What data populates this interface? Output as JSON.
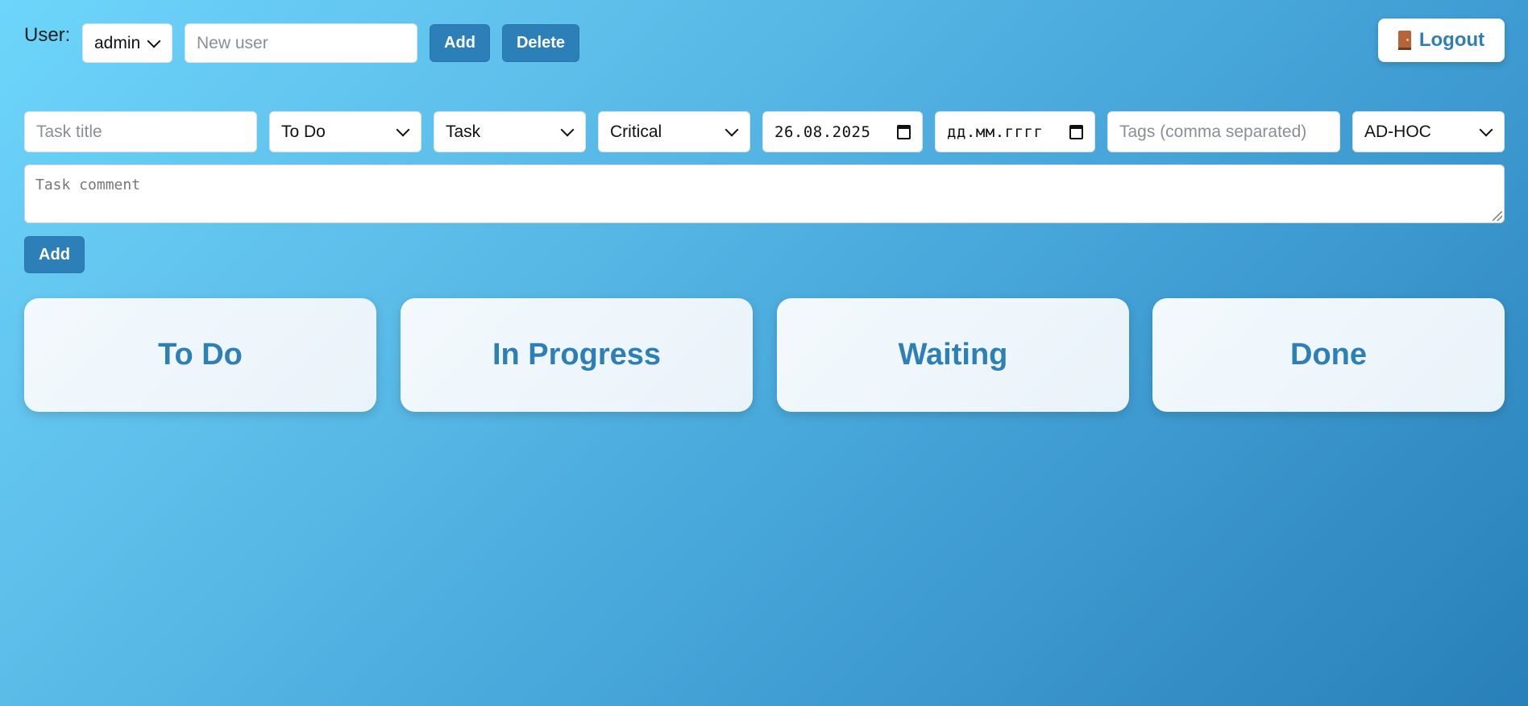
{
  "user_bar": {
    "label": "User:",
    "selected_user": "admin",
    "new_user_placeholder": "New user",
    "add_label": "Add",
    "delete_label": "Delete"
  },
  "logout": {
    "label": "Logout",
    "icon": "door-icon"
  },
  "task_form": {
    "title_placeholder": "Task title",
    "status_value": "To Do",
    "type_value": "Task",
    "priority_value": "Critical",
    "start_date_value": "26.08.2025",
    "due_date_placeholder": "дд.мм.гггг",
    "tags_placeholder": "Tags (comma separated)",
    "category_value": "AD-HOC",
    "comment_placeholder": "Task comment",
    "add_label": "Add"
  },
  "board": {
    "columns": [
      {
        "title": "To Do"
      },
      {
        "title": "In Progress"
      },
      {
        "title": "Waiting"
      },
      {
        "title": "Done"
      }
    ]
  },
  "colors": {
    "accent": "#2d7fb8",
    "background_start": "#6dd5fa",
    "background_end": "#2980b9"
  }
}
